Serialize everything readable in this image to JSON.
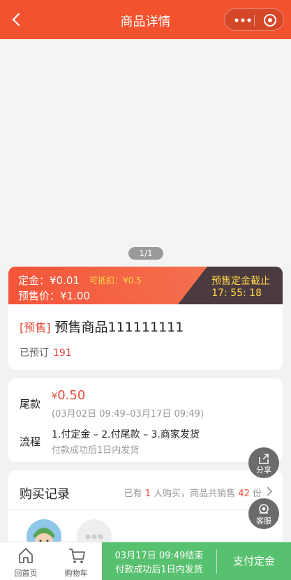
{
  "nav": {
    "title": "商品详情"
  },
  "gallery": {
    "pager": "1/1"
  },
  "presale": {
    "deposit": "定金：¥0.01",
    "deduct": "可抵扣：¥0.5",
    "price": "预售价：¥1.00",
    "deadline_label": "预售定金截止",
    "countdown": "17: 55: 18"
  },
  "product": {
    "tag": "[预售]",
    "name": "预售商品111111111",
    "ordered_label": "已预订",
    "ordered_count": "191"
  },
  "info": {
    "balance_label": "尾款",
    "balance_currency": "¥",
    "balance_amount": "0.50",
    "balance_time": "(03月02日 09:49–03月17日 09:49)",
    "process_label": "流程",
    "process_steps": "1.付定金 – 2.付尾款 – 3.商家发货",
    "process_note": "付款成功后1日内发货"
  },
  "records": {
    "title": "购买记录",
    "summary_prefix": "已有",
    "buyers": "1",
    "summary_mid": "人购买，商品共销售",
    "sold": "42",
    "summary_suffix": "份"
  },
  "fabs": {
    "share": "分享",
    "service": "客服"
  },
  "bottom": {
    "home": "回首页",
    "cart": "购物车",
    "ends": "03月17日 09:49结束",
    "ship": "付款成功后1日内发货",
    "pay": "支付定金"
  },
  "colors": {
    "accent": "#f2522d",
    "price_red": "#e64a3b",
    "pay_green": "#58c16f",
    "countdown_yellow": "#ffd54a"
  }
}
